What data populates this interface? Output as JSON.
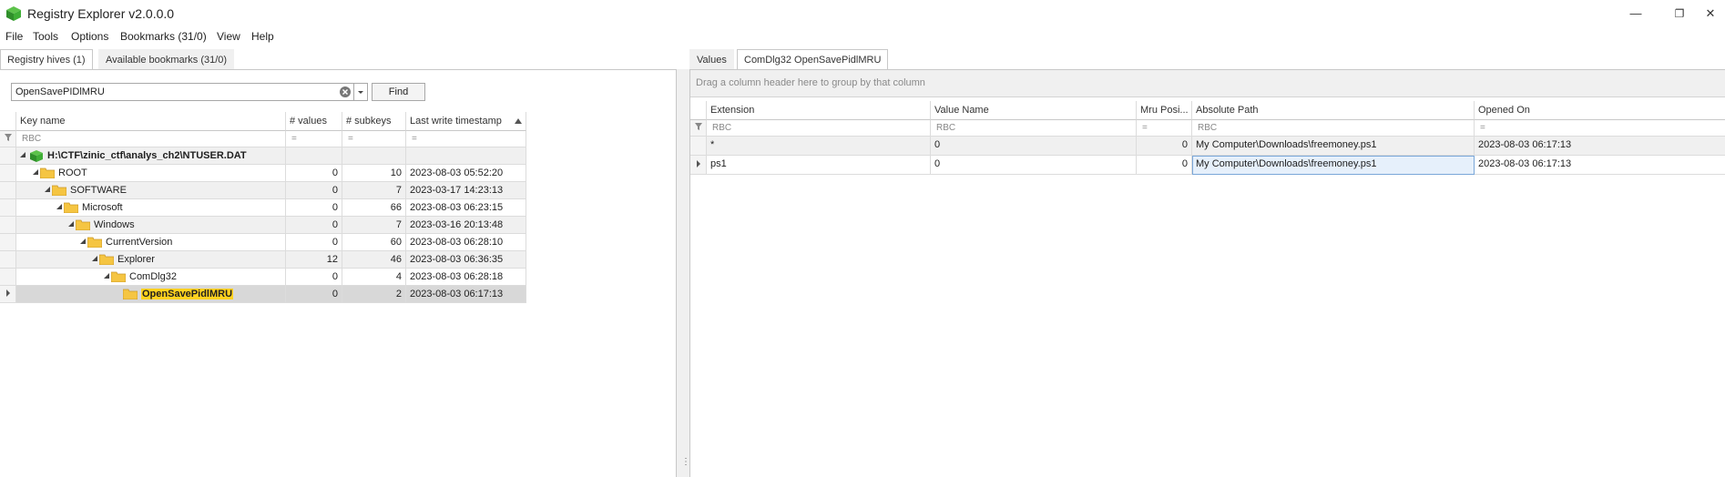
{
  "window": {
    "title": "Registry Explorer v2.0.0.0",
    "minimize_glyph": "—",
    "restore_glyph": "❐",
    "close_glyph": "✕"
  },
  "menu": [
    "File",
    "Tools",
    "Options",
    "Bookmarks (31/0)",
    "View",
    "Help"
  ],
  "left_tabs": [
    {
      "label": "Registry hives (1)",
      "active": true
    },
    {
      "label": "Available bookmarks (31/0)",
      "active": false
    }
  ],
  "search": {
    "value": "OpenSavePIDlMRU",
    "find_label": "Find"
  },
  "tree_grid": {
    "columns": [
      "Key name",
      "# values",
      "# subkeys",
      "Last write timestamp"
    ],
    "filter_symbols": [
      "RBC",
      "=",
      "=",
      "="
    ],
    "hive": {
      "label": "H:\\CTF\\zinic_ctf\\analys_ch2\\NTUSER.DAT"
    },
    "rows": [
      {
        "name": "ROOT",
        "values": "0",
        "subkeys": "10",
        "timestamp": "2023-08-03 05:52:20"
      },
      {
        "name": "SOFTWARE",
        "values": "0",
        "subkeys": "7",
        "timestamp": "2023-03-17 14:23:13"
      },
      {
        "name": "Microsoft",
        "values": "0",
        "subkeys": "66",
        "timestamp": "2023-08-03 06:23:15"
      },
      {
        "name": "Windows",
        "values": "0",
        "subkeys": "7",
        "timestamp": "2023-03-16 20:13:48"
      },
      {
        "name": "CurrentVersion",
        "values": "0",
        "subkeys": "60",
        "timestamp": "2023-08-03 06:28:10"
      },
      {
        "name": "Explorer",
        "values": "12",
        "subkeys": "46",
        "timestamp": "2023-08-03 06:36:35"
      },
      {
        "name": "ComDlg32",
        "values": "0",
        "subkeys": "4",
        "timestamp": "2023-08-03 06:28:18"
      },
      {
        "name": "OpenSavePidlMRU",
        "values": "0",
        "subkeys": "2",
        "timestamp": "2023-08-03 06:17:13"
      }
    ]
  },
  "right_tabs": [
    {
      "label": "Values",
      "active": false
    },
    {
      "label": "ComDlg32 OpenSavePidlMRU",
      "active": true
    }
  ],
  "values_grid": {
    "group_hint": "Drag a column header here to group by that column",
    "columns": [
      "Extension",
      "Value Name",
      "Mru Posi...",
      "Absolute Path",
      "Opened On"
    ],
    "filter_symbols": [
      "RBC",
      "RBC",
      "=",
      "RBC",
      "="
    ],
    "rows": [
      {
        "extension": "*",
        "value_name": "0",
        "mru": "0",
        "path": "My Computer\\Downloads\\freemoney.ps1",
        "opened": "2023-08-03 06:17:13"
      },
      {
        "extension": "ps1",
        "value_name": "0",
        "mru": "0",
        "path": "My Computer\\Downloads\\freemoney.ps1",
        "opened": "2023-08-03 06:17:13"
      }
    ]
  },
  "colors": {
    "highlight": "#ffd21e",
    "folder": "#f5c542",
    "hive_icon": "#3aa63a",
    "selection_border": "#7aa7d8"
  }
}
